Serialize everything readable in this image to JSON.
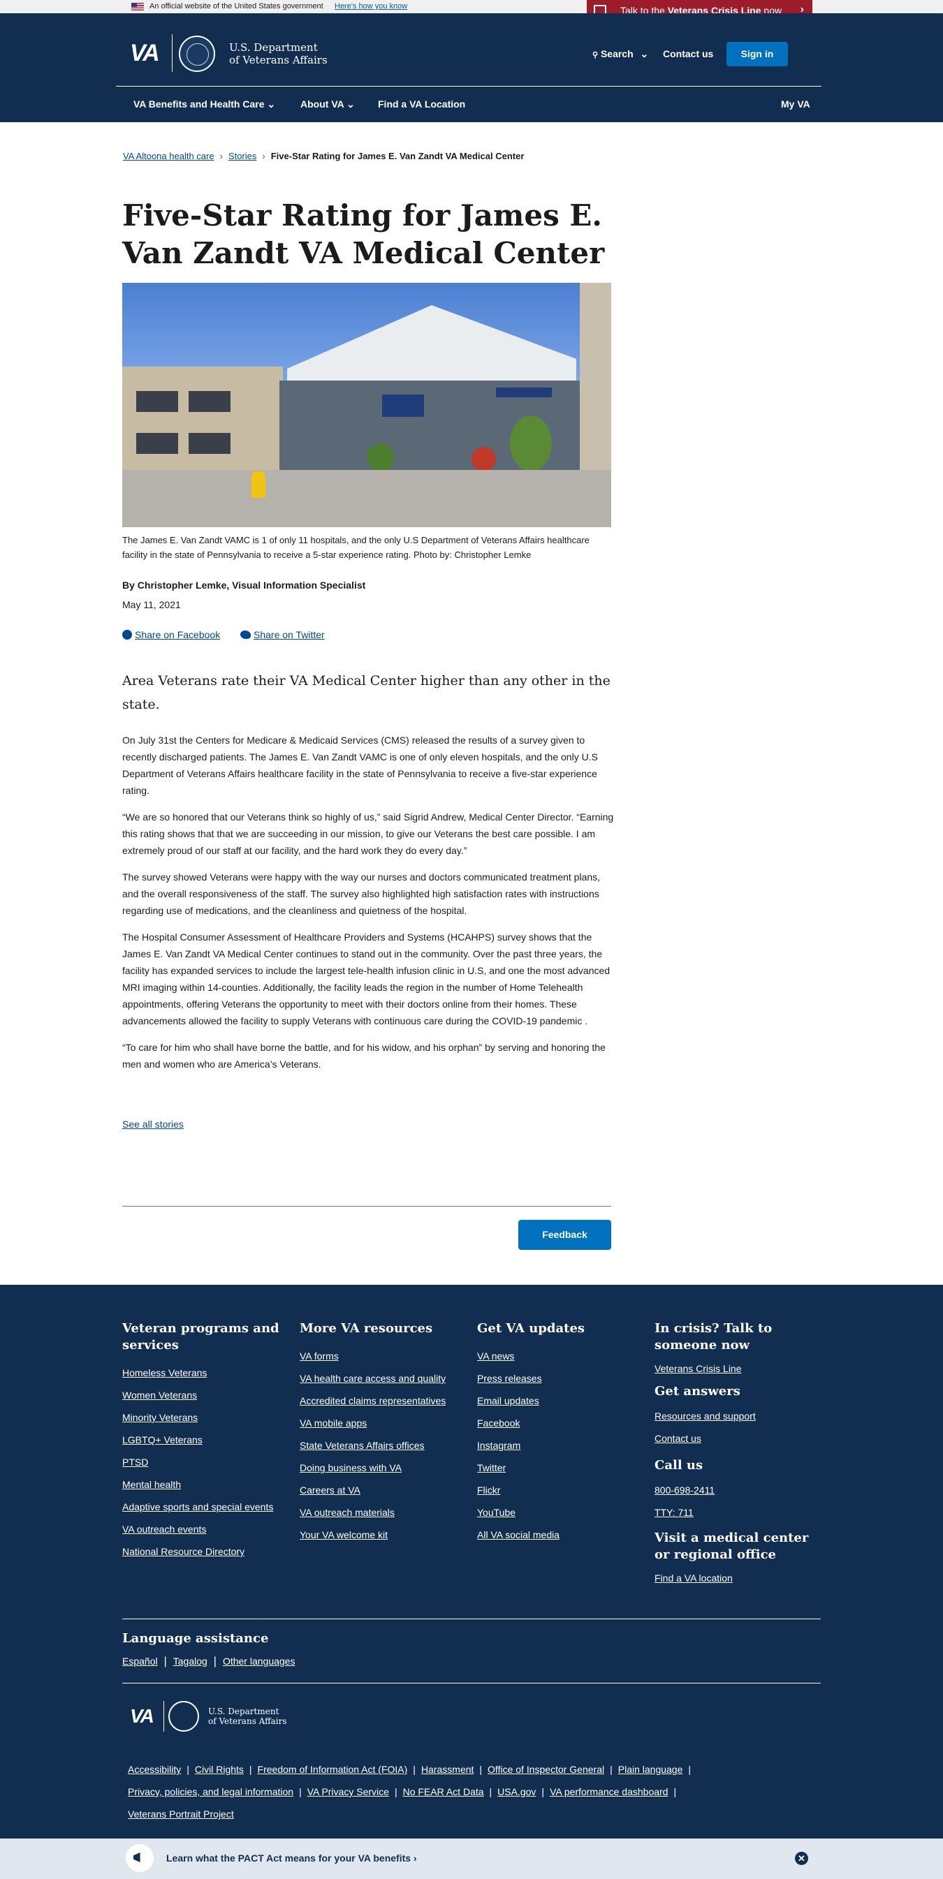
{
  "gov_banner": {
    "text": "An official website of the United States government",
    "link": "Here's how you know"
  },
  "crisis_line": {
    "prefix": "Talk to the ",
    "bold": "Veterans Crisis Line",
    "suffix": " now"
  },
  "header": {
    "logo_text": "VA",
    "dept_line1": "U.S. Department",
    "dept_line2": "of Veterans Affairs",
    "search": "Search",
    "contact": "Contact us",
    "sign_in": "Sign in",
    "nav": [
      {
        "label": "VA Benefits and Health Care"
      },
      {
        "label": "About VA"
      },
      {
        "label": "Find a VA Location"
      },
      {
        "label": "My VA"
      }
    ]
  },
  "breadcrumb": [
    "VA Altoona health care",
    "Stories",
    "Five-Star Rating for James E. Van Zandt VA Medical Center"
  ],
  "article": {
    "title": "Five-Star Rating for James E. Van Zandt VA Medical Center",
    "caption": "The James E. Van Zandt VAMC is 1 of only 11 hospitals, and the only U.S Department of Veterans Affairs healthcare facility in the state of Pennsylvania to receive a 5-star experience rating. Photo by: Christopher Lemke",
    "byline": "By Christopher Lemke, Visual Information Specialist",
    "date": "May 11, 2021",
    "share_facebook": "Share on Facebook",
    "share_twitter": "Share on Twitter",
    "lead": "Area Veterans rate their VA Medical Center higher than any other in the state.",
    "paragraphs": [
      "On July 31st the Centers for Medicare & Medicaid Services (CMS) released the results of a survey given to recently discharged patients. The James E. Van Zandt VAMC is one of only eleven hospitals, and the only U.S Department of Veterans Affairs healthcare  facility in the state of Pennsylvania to receive a five-star experience rating.",
      "“We are so honored that our Veterans think so highly of us,” said Sigrid Andrew, Medical Center Director. “Earning this rating shows that that we are succeeding in our mission, to give our Veterans the best care possible. I am extremely proud of our staff at our facility, and the hard work they do every day.”",
      "The survey showed Veterans were happy with the way our nurses and doctors communicated treatment plans, and the overall responsiveness of the staff. The survey also highlighted high satisfaction rates with instructions regarding use of medications, and the cleanliness and quietness of the hospital.",
      "The Hospital Consumer Assessment of Healthcare Providers and Systems (HCAHPS) survey shows that the James E. Van Zandt VA Medical Center continues to stand out in the community. Over the past three years, the facility has expanded services to include the largest  tele-health infusion clinic in U.S, and one the most  advanced MRI imaging within 14-counties. Additionally, the facility leads the region in the number of Home Telehealth appointments, offering Veterans the opportunity to meet with their doctors online from their homes. These advancements allowed the facility to supply Veterans with continuous care during the COVID-19 pandemic .",
      "  “To care for him who shall have borne the battle, and for his widow, and his orphan” by serving and honoring the men and women who are America’s Veterans."
    ],
    "see_all": "See all stories",
    "feedback": "Feedback"
  },
  "footer": {
    "col1": {
      "title": "Veteran programs and services",
      "links": [
        "Homeless Veterans",
        "Women Veterans",
        "Minority Veterans",
        "LGBTQ+ Veterans",
        "PTSD",
        "Mental health",
        "Adaptive sports and special events",
        "VA outreach events",
        "National Resource Directory"
      ]
    },
    "col2": {
      "title": "More VA resources",
      "links": [
        "VA forms",
        "VA health care access and quality",
        "Accredited claims representatives",
        "VA mobile apps",
        "State Veterans Affairs offices",
        "Doing business with VA",
        "Careers at VA",
        "VA outreach materials",
        "Your VA welcome kit"
      ]
    },
    "col3": {
      "title": "Get VA updates",
      "links": [
        "VA news",
        "Press releases",
        "Email updates",
        "Facebook",
        "Instagram",
        "Twitter",
        "Flickr",
        "YouTube",
        "All VA social media"
      ]
    },
    "col4": {
      "crisis_title": "In crisis? Talk to someone now",
      "crisis_link": "Veterans Crisis Line",
      "answers_title": "Get answers",
      "answers_links": [
        "Resources and support",
        "Contact us"
      ],
      "call_title": "Call us",
      "call_links": [
        "800-698-2411",
        "TTY: 711"
      ],
      "visit_title": "Visit a medical center or regional office",
      "visit_link": "Find a VA location"
    },
    "language": {
      "title": "Language assistance",
      "links": [
        "Español",
        "Tagalog",
        "Other languages"
      ]
    },
    "bottom_links": [
      "Accessibility",
      "Civil Rights",
      "Freedom of Information Act (FOIA)",
      "Harassment",
      "Office of Inspector General",
      "Plain language",
      "Privacy, policies, and legal information",
      "VA Privacy Service",
      "No FEAR Act Data",
      "USA.gov",
      "VA performance dashboard",
      "Veterans Portrait Project"
    ]
  },
  "pact_banner": {
    "text": "Learn what the PACT Act means for your VA benefits ›"
  }
}
